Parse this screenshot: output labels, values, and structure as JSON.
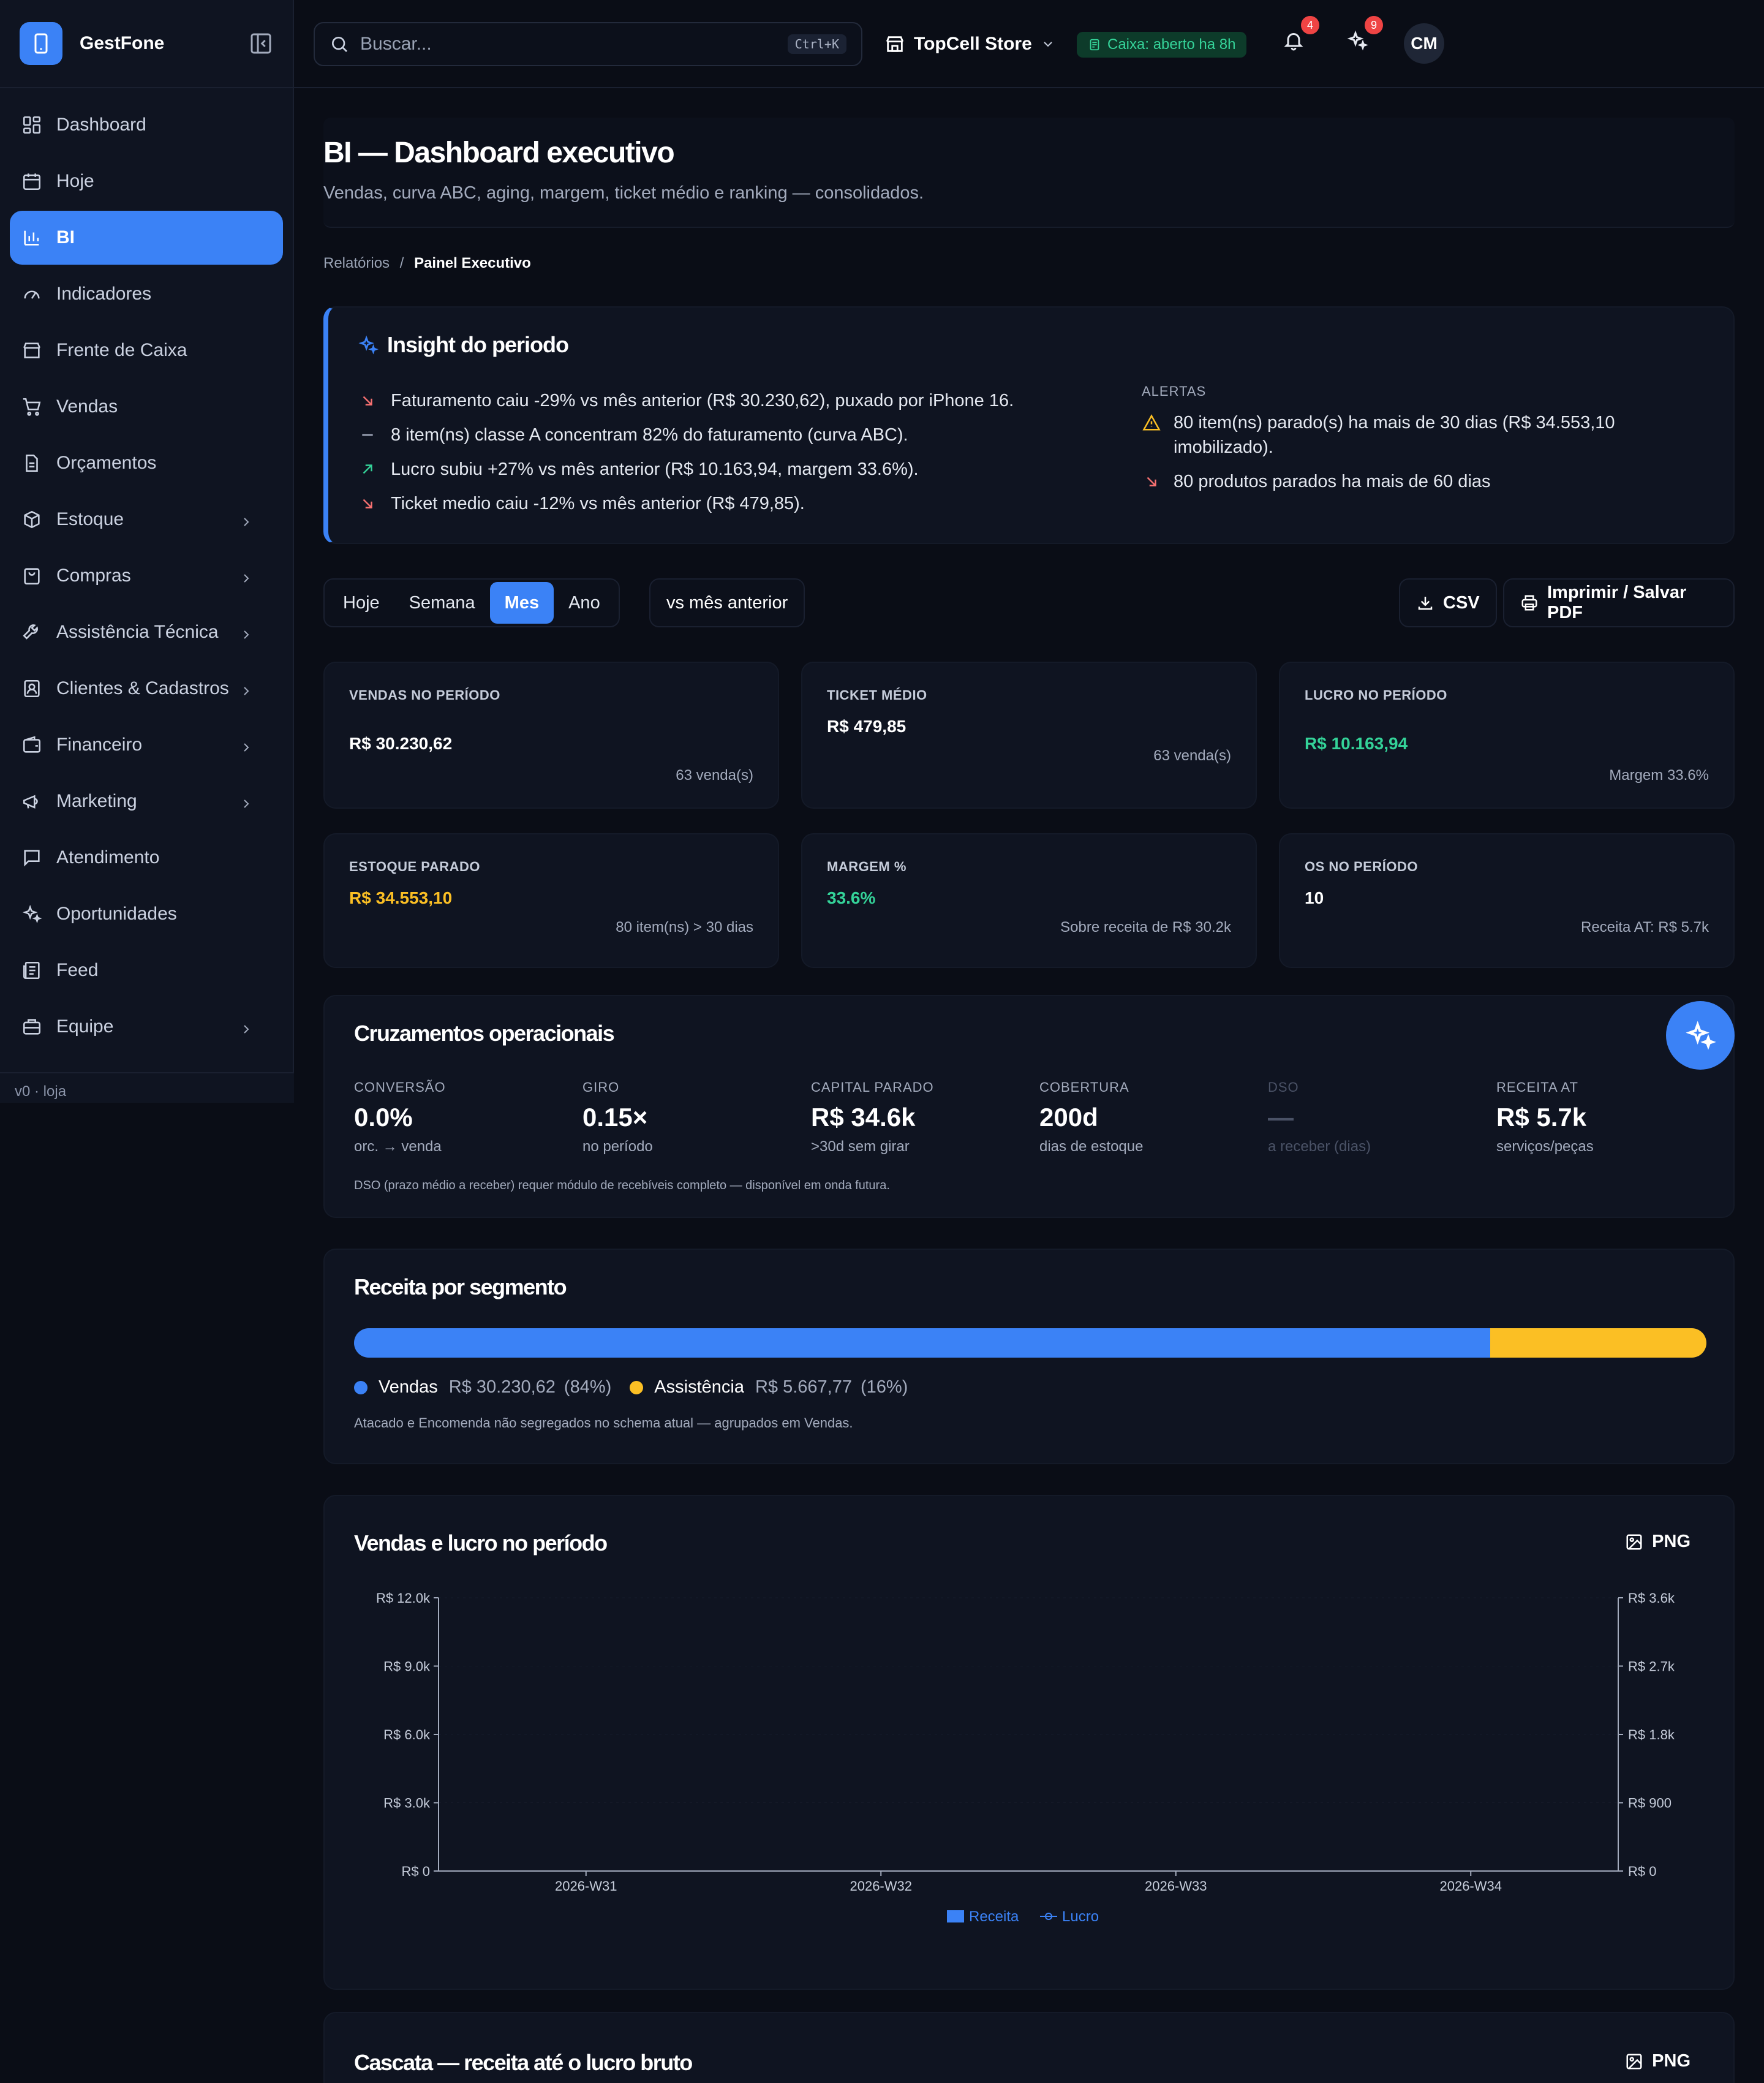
{
  "app": {
    "brand": "GestFone"
  },
  "sidebar": {
    "items": [
      {
        "label": "Dashboard",
        "icon": "layout-grid-icon",
        "chevron": false,
        "active": false
      },
      {
        "label": "Hoje",
        "icon": "calendar-icon",
        "chevron": false,
        "active": false
      },
      {
        "label": "BI",
        "icon": "bar-chart-icon",
        "chevron": false,
        "active": true
      },
      {
        "label": "Indicadores",
        "icon": "gauge-icon",
        "chevron": false,
        "active": false
      },
      {
        "label": "Frente de Caixa",
        "icon": "store-icon",
        "chevron": false,
        "active": false
      },
      {
        "label": "Vendas",
        "icon": "cart-icon",
        "chevron": false,
        "active": false
      },
      {
        "label": "Orçamentos",
        "icon": "document-icon",
        "chevron": false,
        "active": false
      },
      {
        "label": "Estoque",
        "icon": "box-icon",
        "chevron": true,
        "active": false
      },
      {
        "label": "Compras",
        "icon": "bag-icon",
        "chevron": true,
        "active": false
      },
      {
        "label": "Assistência Técnica",
        "icon": "wrench-icon",
        "chevron": true,
        "active": false
      },
      {
        "label": "Clientes & Cadastros",
        "icon": "contact-icon",
        "chevron": true,
        "active": false
      },
      {
        "label": "Financeiro",
        "icon": "wallet-icon",
        "chevron": true,
        "active": false
      },
      {
        "label": "Marketing",
        "icon": "megaphone-icon",
        "chevron": true,
        "active": false
      },
      {
        "label": "Atendimento",
        "icon": "chat-icon",
        "chevron": false,
        "active": false
      },
      {
        "label": "Oportunidades",
        "icon": "sparkles-icon",
        "chevron": false,
        "active": false
      },
      {
        "label": "Feed",
        "icon": "newspaper-icon",
        "chevron": false,
        "active": false
      },
      {
        "label": "Equipe",
        "icon": "briefcase-icon",
        "chevron": true,
        "active": false
      }
    ],
    "version": "v0 · loja"
  },
  "topbar": {
    "search_placeholder": "Buscar...",
    "search_shortcut": "Ctrl+K",
    "store": "TopCell Store",
    "cash_status": "Caixa: aberto ha 8h",
    "notif_count": "4",
    "spark_count": "9",
    "avatar": "CM"
  },
  "page": {
    "title": "BI — Dashboard executivo",
    "subtitle": "Vendas, curva ABC, aging, margem, ticket médio e ranking — consolidados.",
    "crumb_parent": "Relatórios",
    "crumb_sep": "/",
    "crumb_current": "Painel Executivo"
  },
  "insight": {
    "title": "Insight do periodo",
    "items": [
      {
        "text": "Faturamento caiu -29% vs mês anterior (R$ 30.230,62), puxado por iPhone 16.",
        "trend": "down"
      },
      {
        "text": "8 item(ns) classe A concentram 82% do faturamento (curva ABC).",
        "trend": "flat"
      },
      {
        "text": "Lucro subiu +27% vs mês anterior (R$ 10.163,94, margem 33.6%).",
        "trend": "up"
      },
      {
        "text": "Ticket medio caiu -12% vs mês anterior (R$ 479,85).",
        "trend": "down"
      }
    ],
    "alerts_title": "ALERTAS",
    "alerts": [
      {
        "text": "80 item(ns) parado(s) ha mais de 30 dias (R$ 34.553,10 imobilizado).",
        "icon": "warning-icon"
      },
      {
        "text": "80 produtos parados ha mais de 60 dias",
        "icon": "arrow-down-right-icon"
      }
    ]
  },
  "controls": {
    "periods": [
      "Hoje",
      "Semana",
      "Mes",
      "Ano"
    ],
    "active_period": "Mes",
    "compare": "vs mês anterior",
    "csv": "CSV",
    "print": "Imprimir / Salvar PDF"
  },
  "kpis": [
    {
      "label": "VENDAS NO PERÍODO",
      "value": "R$ 30.230,62",
      "note": "63 venda(s)",
      "color": "#ffffff"
    },
    {
      "label": "TICKET MÉDIO",
      "value": "R$ 479,85",
      "note": "63 venda(s)",
      "color": "#ffffff"
    },
    {
      "label": "LUCRO NO PERÍODO",
      "value": "R$ 10.163,94",
      "note": "Margem 33.6%",
      "color": "#34d399"
    },
    {
      "label": "ESTOQUE PARADO",
      "value": "R$ 34.553,10",
      "note": "80 item(ns) > 30 dias",
      "color": "#fbbf24"
    },
    {
      "label": "MARGEM %",
      "value": "33.6%",
      "note": "Sobre receita de R$ 30.2k",
      "color": "#34d399"
    },
    {
      "label": "OS NO PERÍODO",
      "value": "10",
      "note": "Receita AT: R$ 5.7k",
      "color": "#ffffff"
    }
  ],
  "cross": {
    "title": "Cruzamentos operacionais",
    "metrics": [
      {
        "label": "CONVERSÃO",
        "value": "0.0%",
        "sub": "orc. → venda",
        "dim": false
      },
      {
        "label": "GIRO",
        "value": "0.15×",
        "sub": "no período",
        "dim": false
      },
      {
        "label": "CAPITAL PARADO",
        "value": "R$ 34.6k",
        "sub": ">30d sem girar",
        "dim": false
      },
      {
        "label": "COBERTURA",
        "value": "200d",
        "sub": "dias de estoque",
        "dim": false
      },
      {
        "label": "DSO",
        "value": "—",
        "sub": "a receber (dias)",
        "dim": true
      },
      {
        "label": "RECEITA AT",
        "value": "R$ 5.7k",
        "sub": "serviços/peças",
        "dim": false
      }
    ],
    "note": "DSO (prazo médio a receber) requer módulo de recebíveis completo — disponível em onda futura."
  },
  "segment": {
    "title": "Receita por segmento",
    "vendas_label": "Vendas",
    "vendas_value": "R$ 30.230,62",
    "vendas_pct": "(84%)",
    "vendas_share": 84,
    "at_label": "Assistência",
    "at_value": "R$ 5.667,77",
    "at_pct": "(16%)",
    "colors": {
      "vendas": "#3b82f6",
      "at": "#fbbf24"
    },
    "note": "Atacado e Encomenda não segregados no schema atual — agrupados em Vendas."
  },
  "chart_section": {
    "title": "Vendas e lucro no período",
    "png": "PNG"
  },
  "chart_data": {
    "type": "bar",
    "categories": [
      "2026-W31",
      "2026-W32",
      "2026-W33",
      "2026-W34"
    ],
    "series": [
      {
        "name": "Receita",
        "values": [
          0,
          0,
          0,
          0
        ],
        "axis": "left",
        "color": "#3b82f6"
      },
      {
        "name": "Lucro",
        "values": [
          0,
          0,
          0,
          0
        ],
        "axis": "right",
        "color": "#3b82f6",
        "type": "line"
      }
    ],
    "yticks_left": [
      "R$ 0",
      "R$ 3.0k",
      "R$ 6.0k",
      "R$ 9.0k",
      "R$ 12.0k"
    ],
    "yticks_right": [
      "R$ 0",
      "R$ 900",
      "R$ 1.8k",
      "R$ 2.7k",
      "R$ 3.6k"
    ],
    "ylim_left": [
      0,
      12000
    ],
    "ylim_right": [
      0,
      3600
    ],
    "legend": "bottom-center"
  },
  "cascade": {
    "title": "Cascata — receita até o lucro bruto",
    "png": "PNG"
  }
}
